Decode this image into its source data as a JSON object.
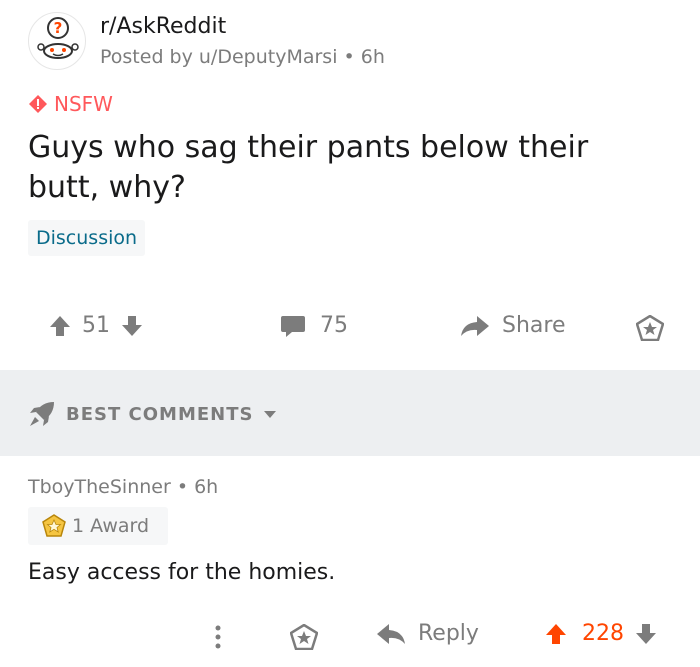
{
  "post": {
    "subreddit": "r/AskReddit",
    "posted_by": "Posted by u/DeputyMarsi • 6h",
    "nsfw_label": "NSFW",
    "title": "Guys who sag their pants below their butt, why?",
    "flair": "Discussion",
    "score": "51",
    "comments": "75",
    "share_label": "Share"
  },
  "sort": {
    "label": "BEST COMMENTS"
  },
  "comment": {
    "author": "TboyTheSinner • 6h",
    "award": "1 Award",
    "body": "Easy access for the homies.",
    "reply_label": "Reply",
    "score": "228"
  },
  "colors": {
    "nsfw": "#ff585b",
    "upvoted": "#ff4500",
    "muted": "#7c7c7c",
    "sortbar_bg": "#edeff1"
  },
  "icons": [
    "reddit-avatar-icon",
    "nsfw-diamond-icon",
    "upvote-icon",
    "downvote-icon",
    "comment-icon",
    "share-icon",
    "award-icon",
    "rocket-icon",
    "caret-down-icon",
    "more-icon",
    "reply-icon"
  ]
}
